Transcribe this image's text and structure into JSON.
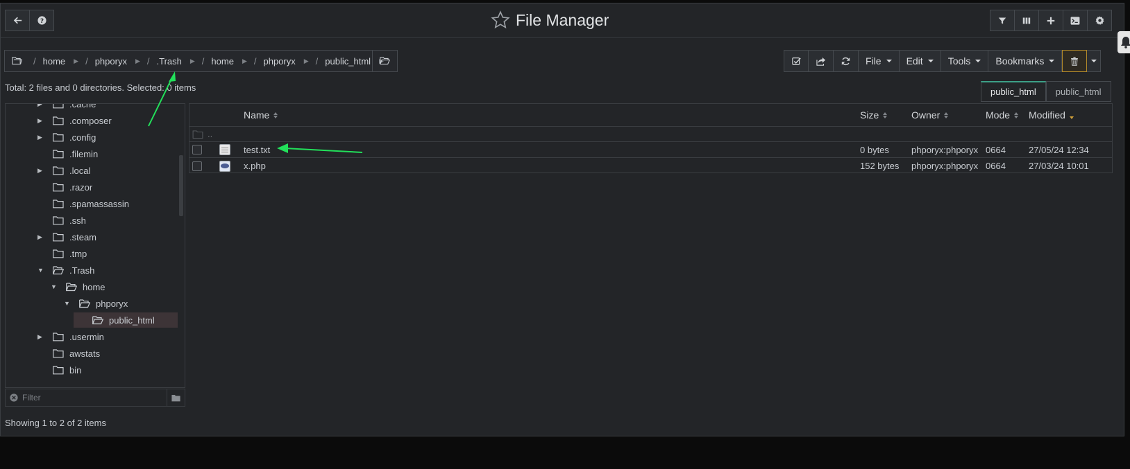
{
  "header": {
    "title": "File Manager",
    "left_buttons": [
      "back-icon",
      "help-icon"
    ],
    "right_buttons": [
      "filter-icon",
      "columns-icon",
      "plus-icon",
      "terminal-icon",
      "gear-icon"
    ]
  },
  "breadcrumb": {
    "items": [
      "home",
      "phporyx",
      ".Trash",
      "home",
      "phporyx",
      "public_html"
    ]
  },
  "toolbar": {
    "menus": [
      "File",
      "Edit",
      "Tools",
      "Bookmarks"
    ],
    "icons": [
      "check-square-icon",
      "share-icon",
      "refresh-icon"
    ],
    "trash_icon": "trash-icon"
  },
  "summary": "Total: 2 files and 0 directories. Selected: 0 items",
  "tabs": [
    "public_html",
    "public_html"
  ],
  "tree": {
    "items": [
      {
        "label": ".cache",
        "expandable": true
      },
      {
        "label": ".composer",
        "expandable": true
      },
      {
        "label": ".config",
        "expandable": true
      },
      {
        "label": ".filemin",
        "expandable": false
      },
      {
        "label": ".local",
        "expandable": true
      },
      {
        "label": ".razor",
        "expandable": false
      },
      {
        "label": ".spamassassin",
        "expandable": false
      },
      {
        "label": ".ssh",
        "expandable": false
      },
      {
        "label": ".steam",
        "expandable": true
      },
      {
        "label": ".tmp",
        "expandable": false
      },
      {
        "label": ".Trash",
        "expandable": true,
        "open": true
      },
      {
        "label": "home",
        "expandable": true,
        "open": true
      },
      {
        "label": "phporyx",
        "expandable": true,
        "open": true
      },
      {
        "label": "public_html",
        "expandable": false,
        "selected": true
      },
      {
        "label": ".usermin",
        "expandable": true
      },
      {
        "label": "awstats",
        "expandable": false
      },
      {
        "label": "bin",
        "expandable": false
      }
    ],
    "filter_placeholder": "Filter"
  },
  "table": {
    "columns": {
      "name": "Name",
      "size": "Size",
      "owner": "Owner",
      "mode": "Mode",
      "modified": "Modified"
    },
    "parent_label": "..",
    "rows": [
      {
        "name": "test.txt",
        "size": "0 bytes",
        "owner": "phporyx:phporyx",
        "mode": "0664",
        "modified": "27/05/24 12:34",
        "icon": "text-file-icon"
      },
      {
        "name": "x.php",
        "size": "152 bytes",
        "owner": "phporyx:phporyx",
        "mode": "0664",
        "modified": "27/03/24 10:01",
        "icon": "php-file-icon"
      }
    ]
  },
  "footer": {
    "showing": "Showing 1 to 2 of 2 items"
  },
  "colors": {
    "background": "#232528",
    "annotation": "#22e05a",
    "accent": "#3c9f87",
    "sort_active": "#d2a13a"
  }
}
